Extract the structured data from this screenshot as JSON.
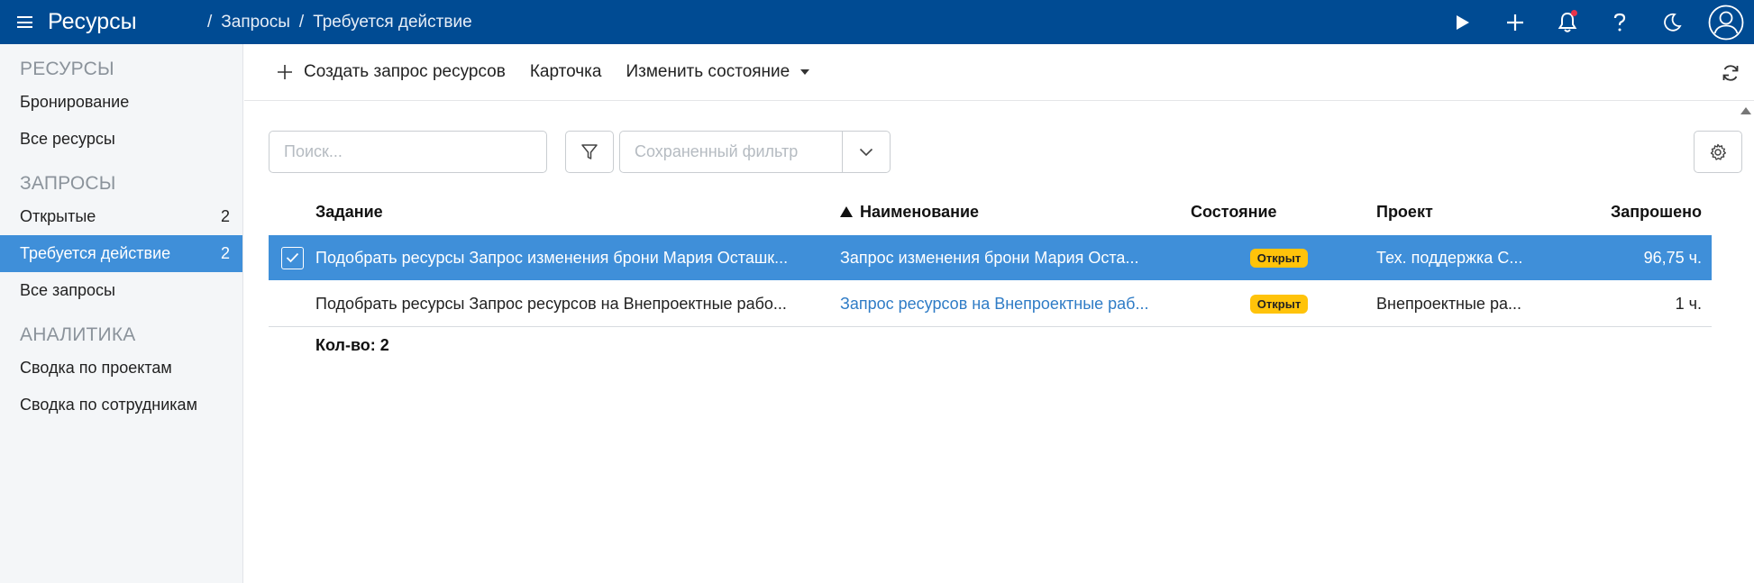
{
  "app": {
    "title": "Ресурсы"
  },
  "breadcrumbs": [
    "Запросы",
    "Требуется действие"
  ],
  "breadcrumb_separator": "/",
  "topbar_icons": [
    "play-icon",
    "plus-icon",
    "bell-icon",
    "help-icon",
    "moon-icon",
    "user-avatar-icon"
  ],
  "sidebar": {
    "sections": [
      {
        "title": "РЕСУРСЫ",
        "items": [
          {
            "label": "Бронирование",
            "count": ""
          },
          {
            "label": "Все ресурсы",
            "count": ""
          }
        ]
      },
      {
        "title": "ЗАПРОСЫ",
        "items": [
          {
            "label": "Открытые",
            "count": "2"
          },
          {
            "label": "Требуется действие",
            "count": "2",
            "active": true
          },
          {
            "label": "Все запросы",
            "count": ""
          }
        ]
      },
      {
        "title": "АНАЛИТИКА",
        "items": [
          {
            "label": "Сводка по проектам",
            "count": ""
          },
          {
            "label": "Сводка по сотрудникам",
            "count": ""
          }
        ]
      }
    ]
  },
  "toolbar": {
    "create_label": "Создать запрос ресурсов",
    "card_label": "Карточка",
    "change_state_label": "Изменить состояние"
  },
  "filters": {
    "search_placeholder": "Поиск...",
    "saved_filter_placeholder": "Сохраненный фильтр"
  },
  "table": {
    "columns": {
      "task": "Задание",
      "name": "Наименование",
      "state": "Состояние",
      "project": "Проект",
      "requested": "Запрошено"
    },
    "sort_column": "name",
    "rows": [
      {
        "selected": true,
        "task": "Подобрать ресурсы Запрос изменения брони Мария Осташк...",
        "name": "Запрос изменения брони Мария Оста...",
        "state": "Открыт",
        "project": "Тех. поддержка С...",
        "requested": "96,75 ч."
      },
      {
        "selected": false,
        "task": "Подобрать ресурсы Запрос ресурсов на Внепроектные рабо...",
        "name": "Запрос ресурсов на Внепроектные раб...",
        "state": "Открыт",
        "project": "Внепроектные ра...",
        "requested": "1 ч."
      }
    ],
    "count_label": "Кол-во: 2"
  },
  "colors": {
    "topbar": "#004b93",
    "selection": "#3f8fd9",
    "badge": "#ffc30a",
    "link": "#2f7cc6",
    "notification_dot": "#e8334a"
  }
}
